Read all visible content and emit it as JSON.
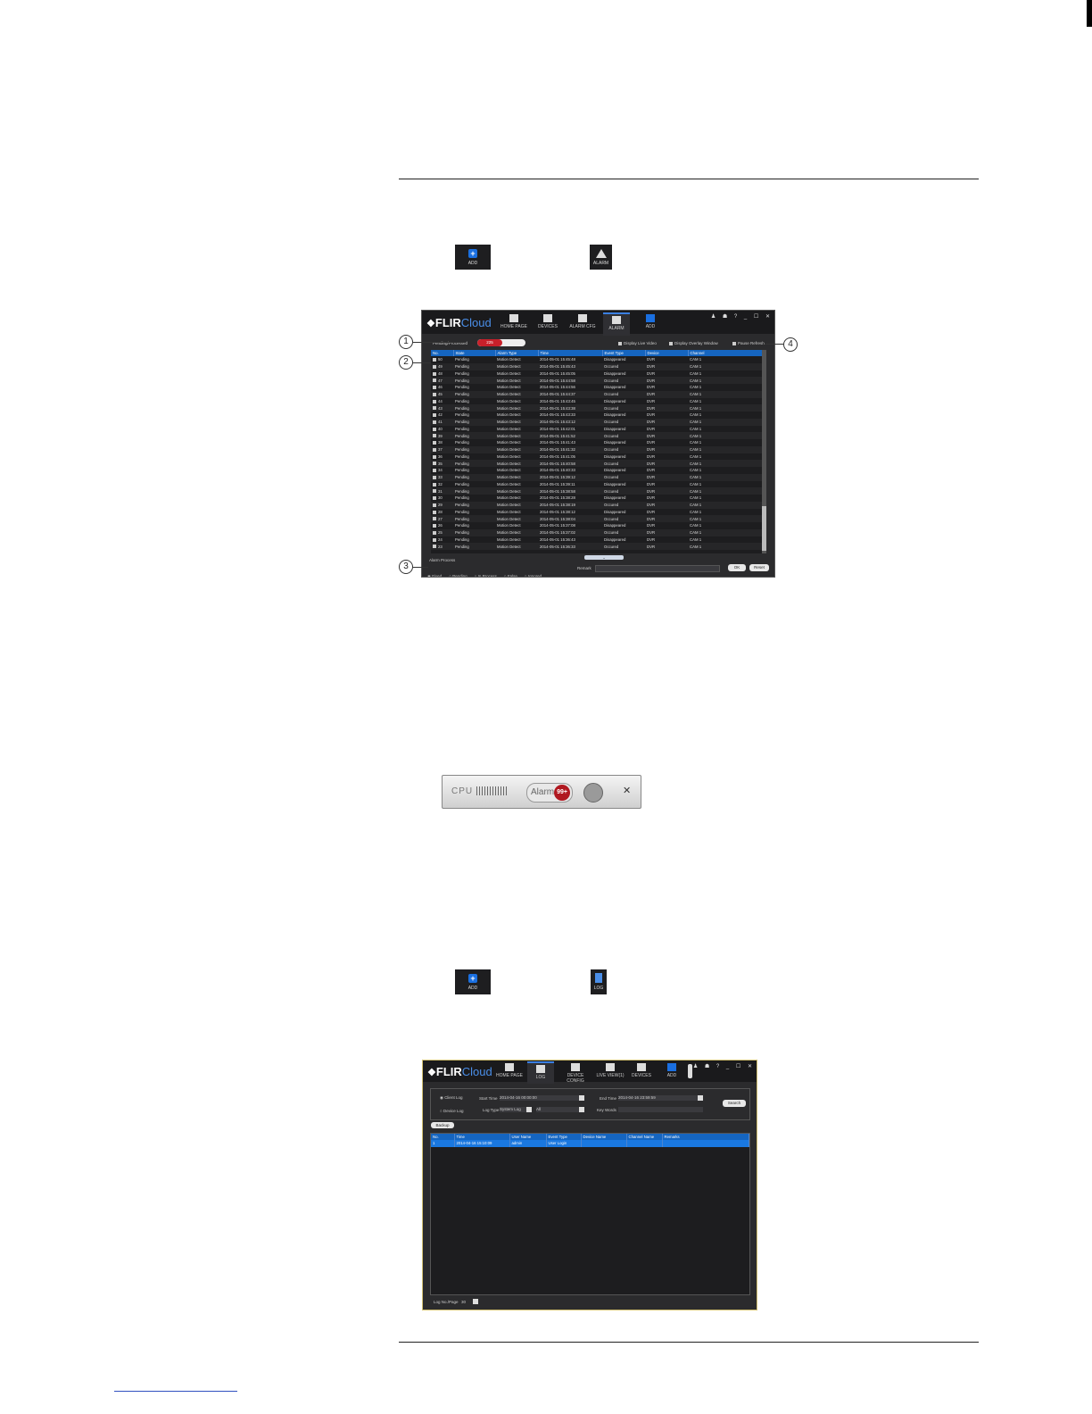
{
  "toolbar_icons": {
    "add_label": "ADD",
    "alarm_label": "ALARM",
    "log_label": "LOG"
  },
  "alarm_window": {
    "brand": "FLIR",
    "brand_suffix": "Cloud",
    "nav": [
      "HOME PAGE",
      "DEVICES",
      "ALARM CFG",
      "ALARM",
      "ADD"
    ],
    "window_controls": "♟ ☗ ? _ ☐ ✕",
    "pending_processed_label": "Pending/Processed",
    "pending_count": "225",
    "display_live_video": "Display Live Video",
    "display_overlay_window": "Display Overlay Window",
    "pause_refresh": "Pause Refresh",
    "columns": [
      "No.",
      "State",
      "Alarm Type",
      "Time",
      "Event Type",
      "Device",
      "Channel"
    ],
    "rows": [
      [
        "50",
        "Pending",
        "Motion Detect",
        "2014-05-01 15:45:48",
        "Disappeared",
        "DVR",
        "CAM 1"
      ],
      [
        "49",
        "Pending",
        "Motion Detect",
        "2014-05-01 15:45:43",
        "Occured",
        "DVR",
        "CAM 1"
      ],
      [
        "48",
        "Pending",
        "Motion Detect",
        "2014-05-01 15:45:05",
        "Disappeared",
        "DVR",
        "CAM 1"
      ],
      [
        "47",
        "Pending",
        "Motion Detect",
        "2014-05-01 15:44:58",
        "Occured",
        "DVR",
        "CAM 1"
      ],
      [
        "46",
        "Pending",
        "Motion Detect",
        "2014-05-01 15:44:56",
        "Disappeared",
        "DVR",
        "CAM 1"
      ],
      [
        "45",
        "Pending",
        "Motion Detect",
        "2014-05-01 15:44:37",
        "Occured",
        "DVR",
        "CAM 1"
      ],
      [
        "44",
        "Pending",
        "Motion Detect",
        "2014-05-01 15:43:45",
        "Disappeared",
        "DVR",
        "CAM 1"
      ],
      [
        "43",
        "Pending",
        "Motion Detect",
        "2014-05-01 15:43:38",
        "Occured",
        "DVR",
        "CAM 1"
      ],
      [
        "42",
        "Pending",
        "Motion Detect",
        "2014-05-01 15:43:33",
        "Disappeared",
        "DVR",
        "CAM 1"
      ],
      [
        "41",
        "Pending",
        "Motion Detect",
        "2014-05-01 15:43:12",
        "Occured",
        "DVR",
        "CAM 1"
      ],
      [
        "40",
        "Pending",
        "Motion Detect",
        "2014-05-01 15:42:01",
        "Disappeared",
        "DVR",
        "CAM 1"
      ],
      [
        "39",
        "Pending",
        "Motion Detect",
        "2014-05-01 15:41:52",
        "Occured",
        "DVR",
        "CAM 1"
      ],
      [
        "38",
        "Pending",
        "Motion Detect",
        "2014-05-01 15:41:43",
        "Disappeared",
        "DVR",
        "CAM 1"
      ],
      [
        "37",
        "Pending",
        "Motion Detect",
        "2014-05-01 15:41:32",
        "Occured",
        "DVR",
        "CAM 1"
      ],
      [
        "36",
        "Pending",
        "Motion Detect",
        "2014-05-01 15:41:05",
        "Disappeared",
        "DVR",
        "CAM 1"
      ],
      [
        "35",
        "Pending",
        "Motion Detect",
        "2014-05-01 15:40:58",
        "Occured",
        "DVR",
        "CAM 1"
      ],
      [
        "34",
        "Pending",
        "Motion Detect",
        "2014-05-01 15:40:33",
        "Disappeared",
        "DVR",
        "CAM 1"
      ],
      [
        "33",
        "Pending",
        "Motion Detect",
        "2014-05-01 15:39:12",
        "Occured",
        "DVR",
        "CAM 1"
      ],
      [
        "32",
        "Pending",
        "Motion Detect",
        "2014-05-01 15:39:11",
        "Disappeared",
        "DVR",
        "CAM 1"
      ],
      [
        "31",
        "Pending",
        "Motion Detect",
        "2014-05-01 15:38:58",
        "Occured",
        "DVR",
        "CAM 1"
      ],
      [
        "30",
        "Pending",
        "Motion Detect",
        "2014-05-01 15:38:28",
        "Disappeared",
        "DVR",
        "CAM 1"
      ],
      [
        "29",
        "Pending",
        "Motion Detect",
        "2014-05-01 15:38:19",
        "Occured",
        "DVR",
        "CAM 1"
      ],
      [
        "28",
        "Pending",
        "Motion Detect",
        "2014-05-01 15:38:12",
        "Disappeared",
        "DVR",
        "CAM 1"
      ],
      [
        "27",
        "Pending",
        "Motion Detect",
        "2014-05-01 15:38:04",
        "Occured",
        "DVR",
        "CAM 1"
      ],
      [
        "26",
        "Pending",
        "Motion Detect",
        "2014-05-01 15:37:08",
        "Disappeared",
        "DVR",
        "CAM 1"
      ],
      [
        "25",
        "Pending",
        "Motion Detect",
        "2014-05-01 15:37:02",
        "Occured",
        "DVR",
        "CAM 1"
      ],
      [
        "24",
        "Pending",
        "Motion Detect",
        "2014-05-01 15:36:43",
        "Disappeared",
        "DVR",
        "CAM 1"
      ],
      [
        "23",
        "Pending",
        "Motion Detect",
        "2014-05-01 15:36:33",
        "Occured",
        "DVR",
        "CAM 1"
      ]
    ],
    "alarm_process_label": "Alarm Process",
    "process_options": [
      "Fixed",
      "Pending",
      "In Process",
      "False",
      "Ignored"
    ],
    "remark_label": "Remark",
    "ok_button": "OK",
    "reset_button": "Reset"
  },
  "callouts": [
    "1",
    "2",
    "3",
    "4"
  ],
  "alarm_bar": {
    "cpu_label": "CPU",
    "alarm_label": "Alarm",
    "alarm_count": "99+",
    "close_glyph": "✕"
  },
  "log_window": {
    "brand": "FLIR",
    "brand_suffix": "Cloud",
    "nav": [
      "HOME PAGE",
      "LOG",
      "DEVICE CONFIG",
      "LIVE VIEW(1)",
      "DEVICES",
      "ADD"
    ],
    "window_controls": "♟ ☗ ? _ ☐ ✕",
    "client_log": "Client Log",
    "device_log": "Device Log",
    "start_time_label": "Start Time",
    "start_time_value": "2014-04-16 00:00:00",
    "end_time_label": "End Time",
    "end_time_value": "2014-04-16 23:59:59",
    "log_type_label": "Log Type",
    "log_type_value": "System Log",
    "log_subtype_value": "All",
    "key_words_label": "Key Words",
    "search_button": "Search",
    "backup_button": "Backup",
    "columns": [
      "No.",
      "Time",
      "User Name",
      "Event Type",
      "Device Name",
      "Channel Name",
      "Remarks"
    ],
    "rows": [
      [
        "1",
        "2014-04-16 15:10:09",
        "admin",
        "User Login",
        "",
        "",
        ""
      ]
    ],
    "log_per_page_label": "Log No./Page",
    "log_per_page_value": "30"
  }
}
